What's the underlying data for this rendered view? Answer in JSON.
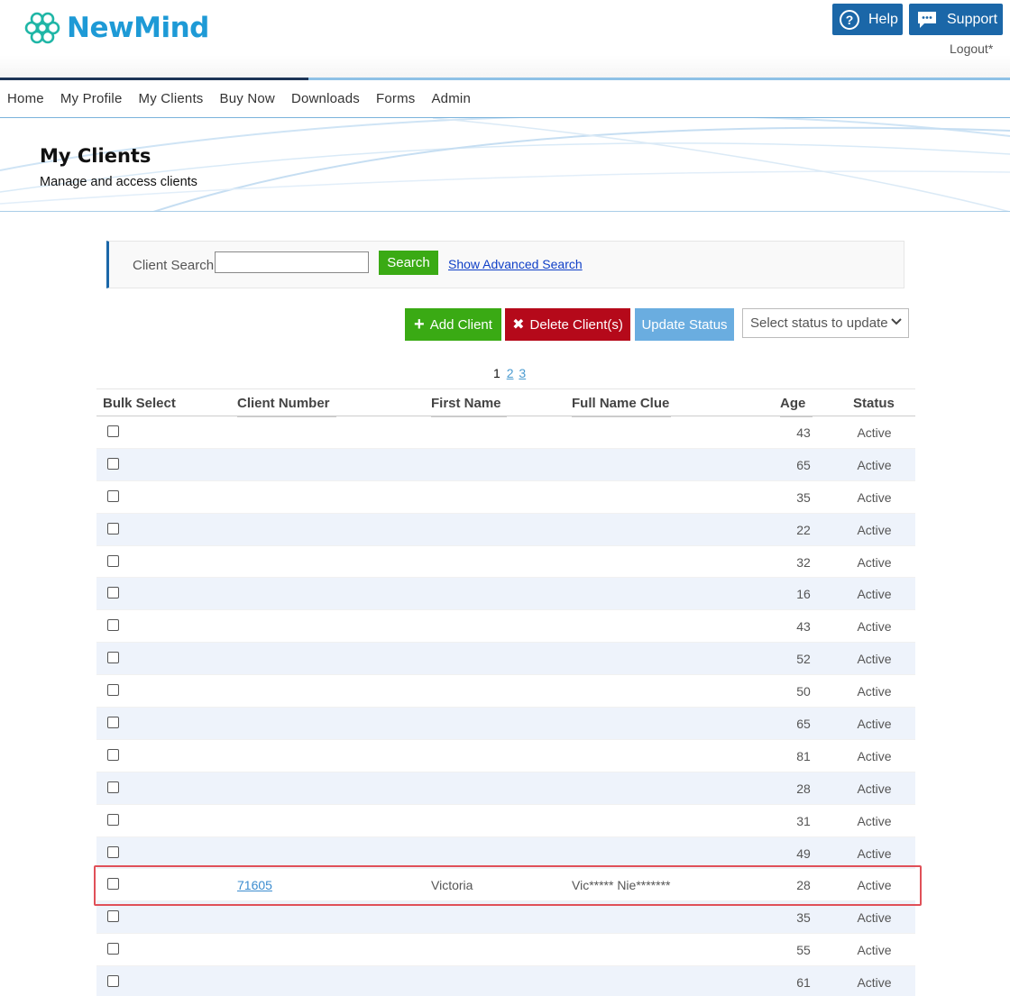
{
  "header": {
    "logo_text": "NewMind",
    "help_label": "Help",
    "support_label": "Support",
    "logout_label": "Logout*",
    "brand_color": "#1e9ad6",
    "icons": [
      "logo-icon",
      "question-circle-icon",
      "chat-bubble-icon"
    ]
  },
  "nav": {
    "items": [
      "Home",
      "My Profile",
      "My Clients",
      "Buy Now",
      "Downloads",
      "Forms",
      "Admin"
    ]
  },
  "banner": {
    "title": "My Clients",
    "subtitle": "Manage and access clients"
  },
  "search": {
    "label": "Client Search",
    "value": "",
    "button_label": "Search",
    "advanced_link": "Show Advanced Search"
  },
  "actions": {
    "add_label": "Add Client",
    "delete_label": "Delete Client(s)",
    "update_label": "Update Status",
    "status_select_value": "Select status to update",
    "colors": {
      "add": "#3aaa14",
      "delete": "#b5091a",
      "update": "#6aade0"
    }
  },
  "pagination": {
    "current": "1",
    "pages": [
      "2",
      "3"
    ]
  },
  "table": {
    "headers": [
      "Bulk Select",
      "Client Number",
      "First Name",
      "Full Name Clue",
      "Age",
      "Status"
    ],
    "rows": [
      {
        "client_number": "",
        "first_name": "",
        "clue": "",
        "age": "43",
        "status": "Active"
      },
      {
        "client_number": "",
        "first_name": "",
        "clue": "",
        "age": "65",
        "status": "Active"
      },
      {
        "client_number": "",
        "first_name": "",
        "clue": "",
        "age": "35",
        "status": "Active"
      },
      {
        "client_number": "",
        "first_name": "",
        "clue": "",
        "age": "22",
        "status": "Active"
      },
      {
        "client_number": "",
        "first_name": "",
        "clue": "",
        "age": "32",
        "status": "Active"
      },
      {
        "client_number": "",
        "first_name": "",
        "clue": "",
        "age": "16",
        "status": "Active"
      },
      {
        "client_number": "",
        "first_name": "",
        "clue": "",
        "age": "43",
        "status": "Active"
      },
      {
        "client_number": "",
        "first_name": "",
        "clue": "",
        "age": "52",
        "status": "Active"
      },
      {
        "client_number": "",
        "first_name": "",
        "clue": "",
        "age": "50",
        "status": "Active"
      },
      {
        "client_number": "",
        "first_name": "",
        "clue": "",
        "age": "65",
        "status": "Active"
      },
      {
        "client_number": "",
        "first_name": "",
        "clue": "",
        "age": "81",
        "status": "Active"
      },
      {
        "client_number": "",
        "first_name": "",
        "clue": "",
        "age": "28",
        "status": "Active"
      },
      {
        "client_number": "",
        "first_name": "",
        "clue": "",
        "age": "31",
        "status": "Active"
      },
      {
        "client_number": "",
        "first_name": "",
        "clue": "",
        "age": "49",
        "status": "Active"
      },
      {
        "client_number": "71605",
        "first_name": "Victoria",
        "clue": "Vic***** Nie*******",
        "age": "28",
        "status": "Active",
        "highlighted": true
      },
      {
        "client_number": "",
        "first_name": "",
        "clue": "",
        "age": "35",
        "status": "Active"
      },
      {
        "client_number": "",
        "first_name": "",
        "clue": "",
        "age": "55",
        "status": "Active"
      },
      {
        "client_number": "",
        "first_name": "",
        "clue": "",
        "age": "61",
        "status": "Active"
      }
    ]
  }
}
